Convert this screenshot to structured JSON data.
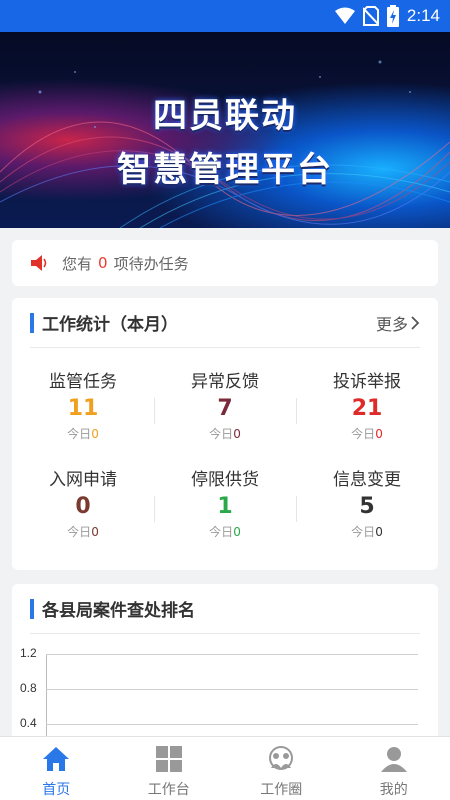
{
  "status_bar": {
    "time": "2:14"
  },
  "banner": {
    "title_line1": "四员联动",
    "title_line2": "智慧管理平台"
  },
  "notice": {
    "prefix": "您有",
    "count": "0",
    "suffix": "项待办任务"
  },
  "work_stats": {
    "title": "工作统计（本月）",
    "more": "更多",
    "items": [
      {
        "label": "监管任务",
        "value": "11",
        "today_label": "今日",
        "today": "0",
        "color": "#f0a020"
      },
      {
        "label": "异常反馈",
        "value": "7",
        "today_label": "今日",
        "today": "0",
        "color": "#7a2a3a"
      },
      {
        "label": "投诉举报",
        "value": "21",
        "today_label": "今日",
        "today": "0",
        "color": "#e02a2a"
      },
      {
        "label": "入网申请",
        "value": "0",
        "today_label": "今日",
        "today": "0",
        "color": "#7a3a30"
      },
      {
        "label": "停限供货",
        "value": "1",
        "today_label": "今日",
        "today": "0",
        "color": "#2aa84a"
      },
      {
        "label": "信息变更",
        "value": "5",
        "today_label": "今日",
        "today": "0",
        "color": "#333333"
      }
    ]
  },
  "ranking": {
    "title": "各县局案件查处排名",
    "chart_data": {
      "type": "bar",
      "y_ticks": [
        "1.2",
        "0.8",
        "0.4"
      ],
      "ylim": [
        0,
        1.2
      ],
      "grid": true
    }
  },
  "tabbar": {
    "tabs": [
      {
        "label": "首页",
        "icon": "home-icon",
        "active": true
      },
      {
        "label": "工作台",
        "icon": "grid-icon",
        "active": false
      },
      {
        "label": "工作圈",
        "icon": "community-icon",
        "active": false
      },
      {
        "label": "我的",
        "icon": "user-icon",
        "active": false
      }
    ]
  }
}
